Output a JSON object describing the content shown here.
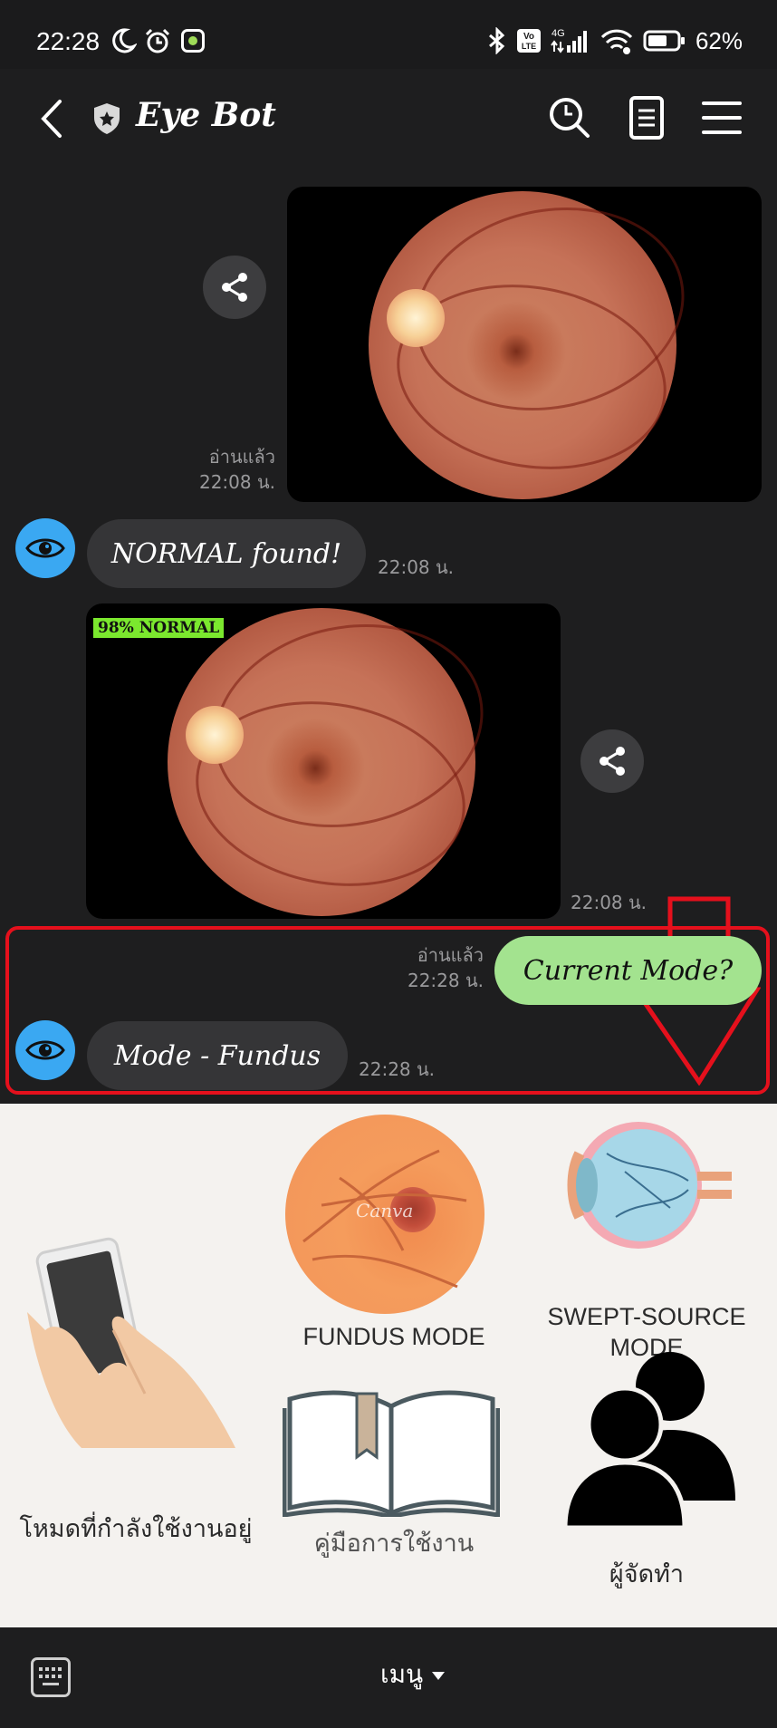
{
  "status_bar": {
    "time": "22:28",
    "battery": "62%",
    "network": "4G",
    "volte": "Vo LTE",
    "icons": [
      "moon-icon",
      "alarm-icon",
      "app-notification-icon",
      "bluetooth-icon",
      "volte-icon",
      "signal-icon",
      "wifi-icon",
      "battery-icon"
    ]
  },
  "header": {
    "title": "Eye Bot",
    "icons": [
      "back-icon",
      "shield-icon",
      "search-icon",
      "notes-icon",
      "hamburger-icon"
    ]
  },
  "messages": {
    "m1": {
      "read": "อ่านแล้ว",
      "time": "22:08 น."
    },
    "m2": {
      "text": "NORMAL found!",
      "time": "22:08 น."
    },
    "m3": {
      "overlay_label": "98% NORMAL",
      "time": "22:08 น."
    },
    "m4": {
      "text": "Current Mode?",
      "read": "อ่านแล้ว",
      "time": "22:28 น."
    },
    "m5": {
      "text": "Mode - Fundus",
      "time": "22:28 น."
    }
  },
  "menu": {
    "current_mode": "โหมดที่กำลังใช้งานอยู่",
    "fundus_mode": "FUNDUS MODE",
    "fundus_watermark": "Canva",
    "swept_source_line1": "SWEPT-SOURCE",
    "swept_source_line2": "MODE",
    "manual": "คู่มือการใช้งาน",
    "creators": "ผู้จัดทำ"
  },
  "bottom_bar": {
    "menu_label": "เมนู"
  },
  "colors": {
    "chat_bg": "#1e1e1f",
    "bubble_dark": "#353537",
    "bubble_green": "#a3e38f",
    "avatar_blue": "#3aa8f2",
    "highlight_red": "#e5101c",
    "label_green": "#7be82e"
  }
}
